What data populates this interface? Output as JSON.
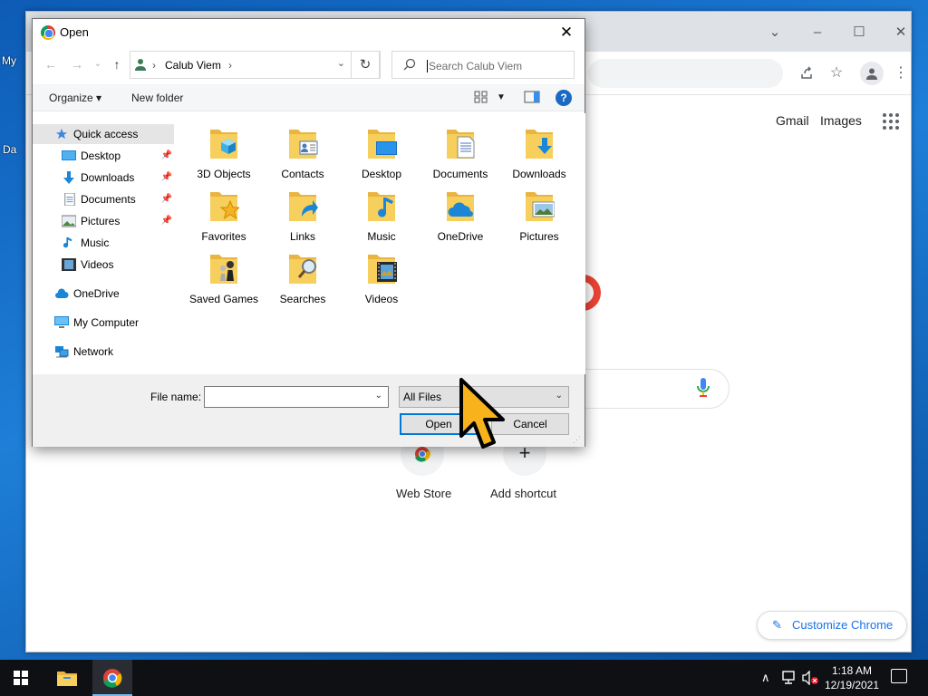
{
  "desktop": {
    "labels": [
      "My",
      "Da"
    ]
  },
  "chrome": {
    "top_links": {
      "gmail": "Gmail",
      "images": "Images"
    },
    "shortcuts": [
      {
        "label": "Web Store"
      },
      {
        "label": "Add shortcut",
        "symbol": "+"
      }
    ],
    "customize_label": "Customize Chrome",
    "window_controls": {
      "minimize": "–",
      "maximize": "☐",
      "close": "✕",
      "tabs_dropdown": "⌄"
    },
    "accent": "#1a73e8"
  },
  "dialog": {
    "title": "Open",
    "close": "✕",
    "nav": {
      "back": "←",
      "forward": "→",
      "recent": "⌄",
      "up": "↑",
      "refresh": "↻"
    },
    "breadcrumb": [
      "Calub Viem"
    ],
    "search_placeholder": "Search Calub Viem",
    "toolbar": {
      "organize": "Organize ▾",
      "new_folder": "New folder",
      "help": "?"
    },
    "nav_pane": [
      {
        "label": "Quick access",
        "icon": "star-icon",
        "selected": true
      },
      {
        "label": "Desktop",
        "icon": "desktop-icon",
        "pinned": true
      },
      {
        "label": "Downloads",
        "icon": "download-icon",
        "pinned": true
      },
      {
        "label": "Documents",
        "icon": "document-icon",
        "pinned": true
      },
      {
        "label": "Pictures",
        "icon": "pictures-icon",
        "pinned": true
      },
      {
        "label": "Music",
        "icon": "music-icon"
      },
      {
        "label": "Videos",
        "icon": "video-icon"
      },
      {
        "label": "OneDrive",
        "icon": "cloud-icon"
      },
      {
        "label": "My Computer",
        "icon": "computer-icon"
      },
      {
        "label": "Network",
        "icon": "network-icon"
      }
    ],
    "files": [
      {
        "label": "3D Objects",
        "overlay": "cube"
      },
      {
        "label": "Contacts",
        "overlay": "contact-card"
      },
      {
        "label": "Desktop",
        "overlay": "monitor"
      },
      {
        "label": "Documents",
        "overlay": "page"
      },
      {
        "label": "Downloads",
        "overlay": "down-arrow"
      },
      {
        "label": "Favorites",
        "overlay": "star"
      },
      {
        "label": "Links",
        "overlay": "link-arrow"
      },
      {
        "label": "Music",
        "overlay": "note"
      },
      {
        "label": "OneDrive",
        "overlay": "cloud"
      },
      {
        "label": "Pictures",
        "overlay": "landscape"
      },
      {
        "label": "Saved Games",
        "overlay": "chess"
      },
      {
        "label": "Searches",
        "overlay": "magnifier"
      },
      {
        "label": "Videos",
        "overlay": "film"
      }
    ],
    "footer": {
      "file_name_label": "File name:",
      "file_name_value": "",
      "filter_value": "All Files",
      "open_label": "Open",
      "cancel_label": "Cancel"
    },
    "folder_color": "#f7cf5c"
  },
  "taskbar": {
    "time": "1:18 AM",
    "date": "12/19/2021",
    "tray_chevron": "∧"
  }
}
